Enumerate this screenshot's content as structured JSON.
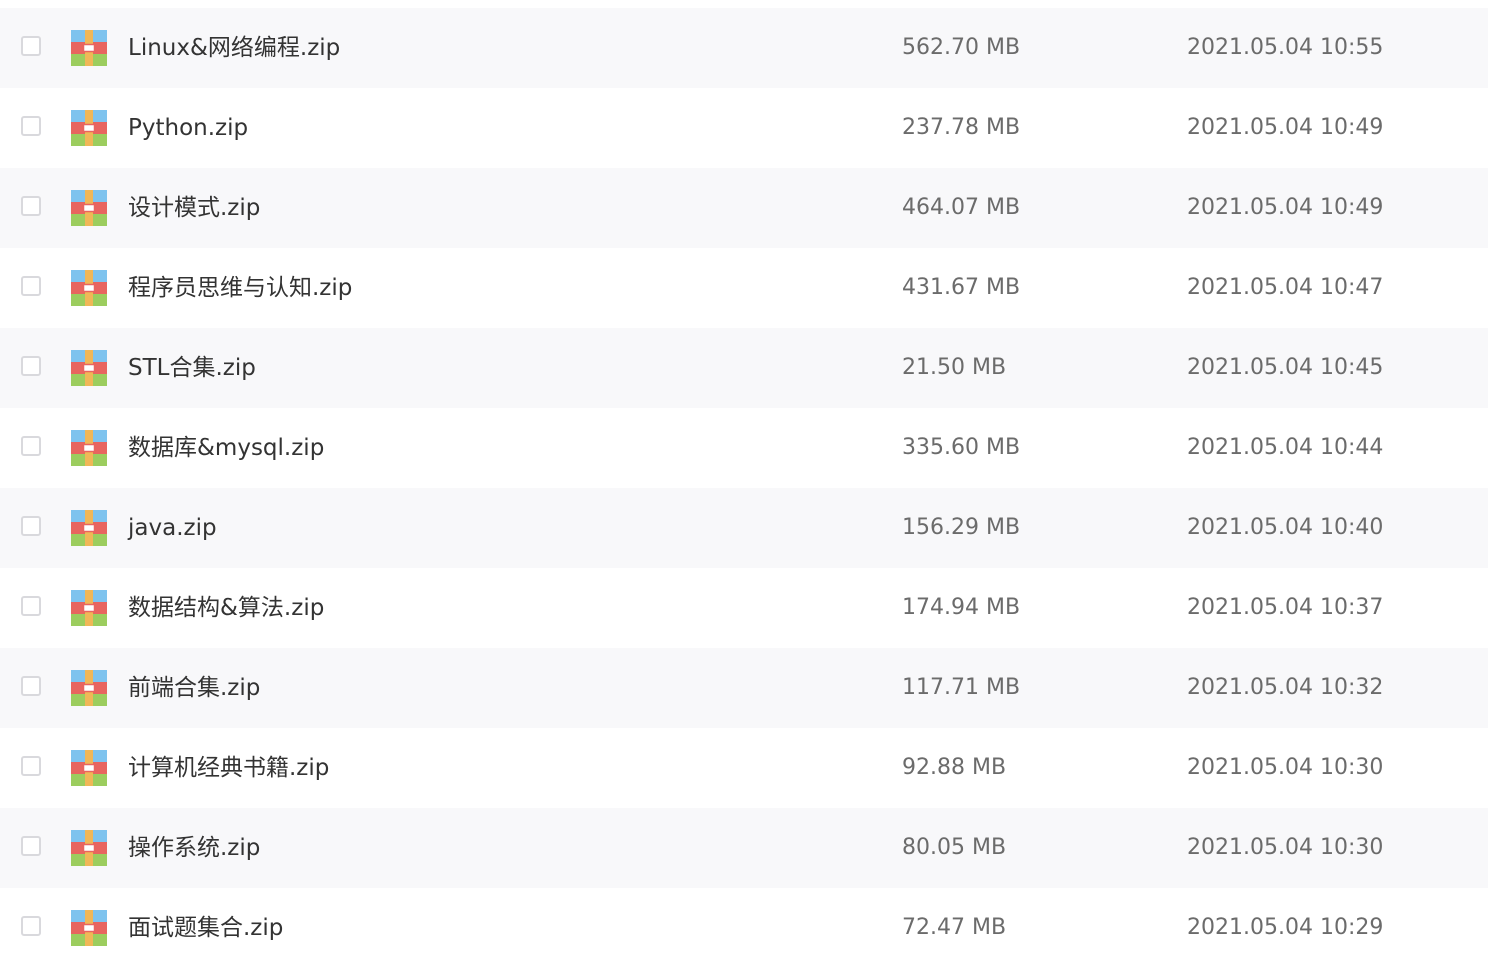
{
  "files": [
    {
      "name": "Linux&网络编程.zip",
      "size": "562.70 MB",
      "date": "2021.05.04 10:55",
      "icon": "zip-archive-icon",
      "checked": false
    },
    {
      "name": "Python.zip",
      "size": "237.78 MB",
      "date": "2021.05.04 10:49",
      "icon": "zip-archive-icon",
      "checked": false
    },
    {
      "name": "设计模式.zip",
      "size": "464.07 MB",
      "date": "2021.05.04 10:49",
      "icon": "zip-archive-icon",
      "checked": false
    },
    {
      "name": "程序员思维与认知.zip",
      "size": "431.67 MB",
      "date": "2021.05.04 10:47",
      "icon": "zip-archive-icon",
      "checked": false
    },
    {
      "name": "STL合集.zip",
      "size": "21.50 MB",
      "date": "2021.05.04 10:45",
      "icon": "zip-archive-icon",
      "checked": false
    },
    {
      "name": "数据库&mysql.zip",
      "size": "335.60 MB",
      "date": "2021.05.04 10:44",
      "icon": "zip-archive-icon",
      "checked": false
    },
    {
      "name": "java.zip",
      "size": "156.29 MB",
      "date": "2021.05.04 10:40",
      "icon": "zip-archive-icon",
      "checked": false
    },
    {
      "name": "数据结构&算法.zip",
      "size": "174.94 MB",
      "date": "2021.05.04 10:37",
      "icon": "zip-archive-icon",
      "checked": false
    },
    {
      "name": "前端合集.zip",
      "size": "117.71 MB",
      "date": "2021.05.04 10:32",
      "icon": "zip-archive-icon",
      "checked": false
    },
    {
      "name": "计算机经典书籍.zip",
      "size": "92.88 MB",
      "date": "2021.05.04 10:30",
      "icon": "zip-archive-icon",
      "checked": false
    },
    {
      "name": "操作系统.zip",
      "size": "80.05 MB",
      "date": "2021.05.04 10:30",
      "icon": "zip-archive-icon",
      "checked": false
    },
    {
      "name": "面试题集合.zip",
      "size": "72.47 MB",
      "date": "2021.05.04 10:29",
      "icon": "zip-archive-icon",
      "checked": false
    }
  ],
  "colors": {
    "row_alt": "#f8f8fa",
    "row_white": "#ffffff",
    "text_primary": "#333333",
    "text_secondary": "#6b6b6b",
    "icon_blue": "#7ec3ee",
    "icon_red": "#e8655f",
    "icon_green": "#9ccd5e",
    "icon_zipper": "#f0b757"
  }
}
